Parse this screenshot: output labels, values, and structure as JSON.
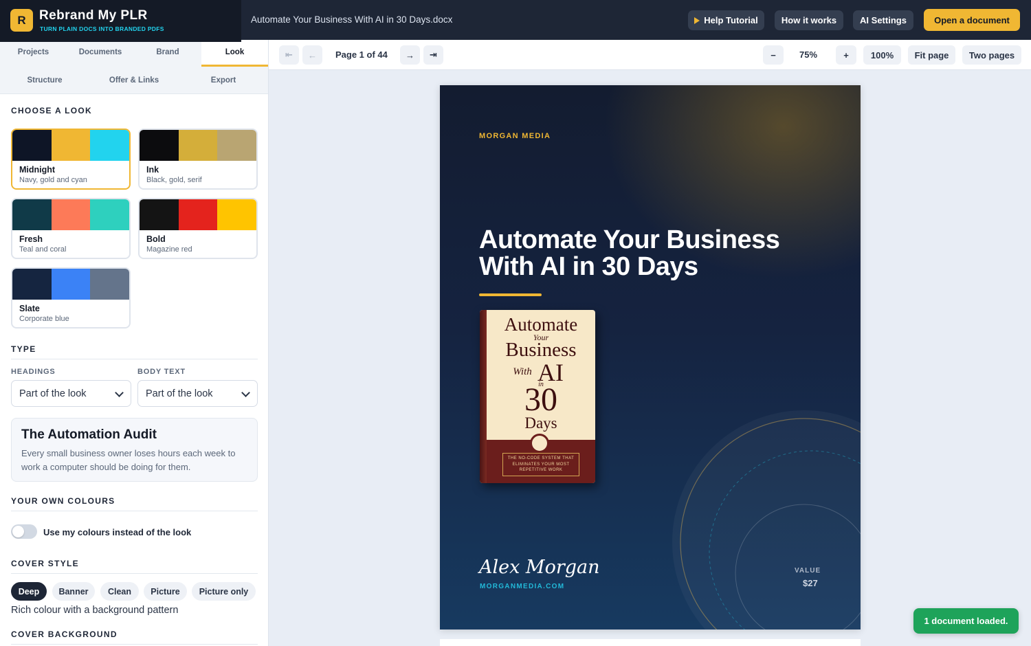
{
  "app": {
    "logo_letter": "R",
    "name": "Rebrand My PLR",
    "tagline": "TURN PLAIN DOCS INTO BRANDED PDFS",
    "document_name": "Automate Your Business With AI in 30 Days.docx"
  },
  "header": {
    "help_label": "Help Tutorial",
    "how_label": "How it works",
    "ai_label": "AI Settings",
    "open_label": "Open a document"
  },
  "tabs": [
    {
      "label": "Projects"
    },
    {
      "label": "Documents"
    },
    {
      "label": "Brand"
    },
    {
      "label": "Look"
    },
    {
      "label": "Structure"
    },
    {
      "label": "Offer & Links"
    },
    {
      "label": "Export"
    }
  ],
  "active_tab": "Look",
  "sections": {
    "choose_look": "CHOOSE A LOOK",
    "type": "TYPE",
    "own_colours": "YOUR OWN COLOURS",
    "cover_style": "COVER STYLE",
    "cover_background": "COVER BACKGROUND"
  },
  "looks": [
    {
      "name": "Midnight",
      "desc": "Navy, gold and cyan",
      "colors": [
        "#0e1526",
        "#f0b733",
        "#22d3ee"
      ],
      "selected": true
    },
    {
      "name": "Ink",
      "desc": "Black, gold, serif",
      "colors": [
        "#0c0c0e",
        "#d4ae3a",
        "#b9a572"
      ]
    },
    {
      "name": "Fresh",
      "desc": "Teal and coral",
      "colors": [
        "#103a48",
        "#fd7a58",
        "#2ed0be"
      ]
    },
    {
      "name": "Bold",
      "desc": "Magazine red",
      "colors": [
        "#141414",
        "#e4231d",
        "#ffc400"
      ]
    },
    {
      "name": "Slate",
      "desc": "Corporate blue",
      "colors": [
        "#152540",
        "#3b82f6",
        "#64748b"
      ]
    }
  ],
  "type": {
    "headings_label": "HEADINGS",
    "headings_value": "Part of the look",
    "body_label": "BODY TEXT",
    "body_value": "Part of the look",
    "preview_title": "The Automation Audit",
    "preview_body": "Every small business owner loses hours each week to work a computer should be doing for them."
  },
  "own_colours": {
    "toggle_label": "Use my colours instead of the look",
    "enabled": false
  },
  "cover_style": {
    "options": [
      "Deep",
      "Banner",
      "Clean",
      "Picture",
      "Picture only"
    ],
    "selected": "Deep",
    "description": "Rich colour with a background pattern"
  },
  "viewer": {
    "first_icon": "⇤",
    "prev_icon": "←",
    "next_icon": "→",
    "last_icon": "⇥",
    "page_label": "Page 1 of 44",
    "zoom_out": "−",
    "zoom_level": "75%",
    "zoom_in": "+",
    "zoom_100": "100%",
    "fit_page": "Fit page",
    "two_pages": "Two pages"
  },
  "cover": {
    "publisher": "MORGAN MEDIA",
    "title": "Automate Your Business With AI in 30 Days",
    "author": "Alex Morgan",
    "website": "MORGANMEDIA.COM",
    "value_label": "VALUE",
    "value": "$27",
    "book": {
      "line1": "Automate",
      "line2": "Your",
      "line3": "Business",
      "line4a": "With",
      "line4b": "AI",
      "line5": "in",
      "line6": "30",
      "line7": "Days",
      "blurb": "THE NO-CODE SYSTEM THAT ELIMINATES YOUR MOST REPETITIVE WORK"
    }
  },
  "toast": "1 document loaded.",
  "colors": {
    "accent": "#f0b733",
    "dark": "#141a26",
    "cyan": "#22d3ee",
    "success": "#1ea35a"
  }
}
